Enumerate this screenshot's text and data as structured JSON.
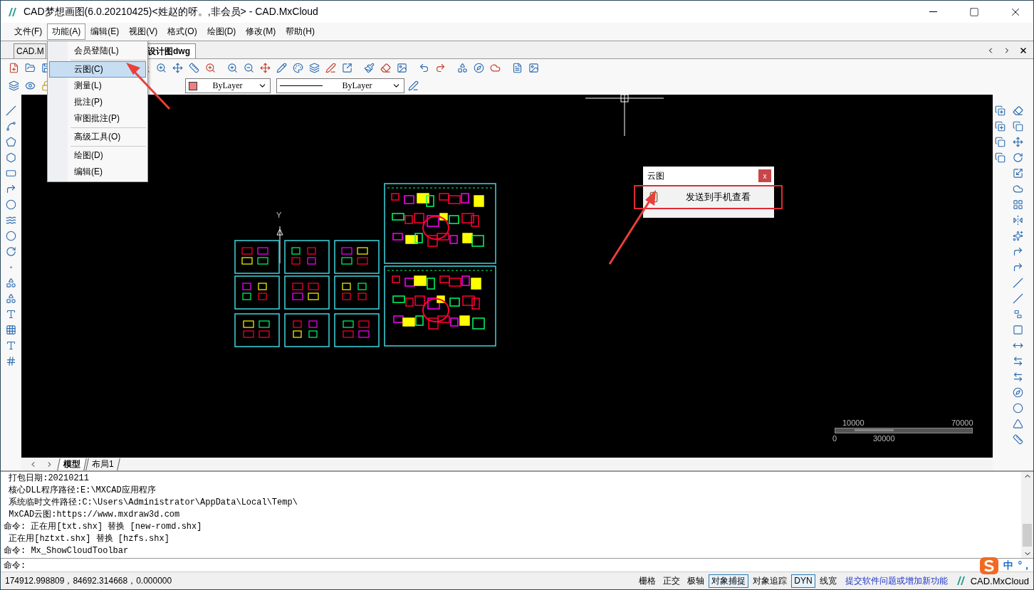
{
  "window": {
    "title": "CAD梦想画图(6.0.20210425)<姓赵的呀。,非会员> - CAD.MxCloud"
  },
  "menu_bar": [
    {
      "label": "文件(F)",
      "selected": false
    },
    {
      "label": "功能(A)",
      "selected": true
    },
    {
      "label": "编辑(E)",
      "selected": false
    },
    {
      "label": "视图(V)",
      "selected": false
    },
    {
      "label": "格式(O)",
      "selected": false
    },
    {
      "label": "绘图(D)",
      "selected": false
    },
    {
      "label": "修改(M)",
      "selected": false
    },
    {
      "label": "帮助(H)",
      "selected": false
    }
  ],
  "open_menu": {
    "items": [
      {
        "label": "会员登陆(L)",
        "selected": false,
        "separator_after": true
      },
      {
        "label": "云图(C)",
        "selected": true,
        "separator_after": false
      },
      {
        "label": "测量(L)",
        "selected": false,
        "separator_after": false
      },
      {
        "label": "批注(P)",
        "selected": false,
        "separator_after": false
      },
      {
        "label": "审图批注(P)",
        "selected": false,
        "separator_after": true
      },
      {
        "label": "高级工具(O)",
        "selected": false,
        "separator_after": true
      },
      {
        "label": "绘图(D)",
        "selected": false,
        "separator_after": false
      },
      {
        "label": "编辑(E)",
        "selected": false,
        "separator_after": false
      }
    ]
  },
  "document_tabs": [
    {
      "label": "CAD.M",
      "selected": false
    },
    {
      "label": "设计图dwg",
      "selected": true
    }
  ],
  "property_bar": {
    "swatch_dropdown": "ByLayer",
    "linetype_dropdown": "ByLayer"
  },
  "canvas": {
    "axis_label": "Y",
    "scale_bar": {
      "top_labels": [
        "10000",
        "70000"
      ],
      "bottom_labels": [
        "0",
        "30000"
      ]
    }
  },
  "cloud_panel": {
    "title": "云图",
    "close": "x",
    "items": [
      {
        "label": "发送到手机查看",
        "highlighted": true
      }
    ]
  },
  "layout_tabs": [
    {
      "label": "模型",
      "selected": true
    },
    {
      "label": "布局1",
      "selected": false
    }
  ],
  "command_output": [
    " 打包日期:20210211",
    " 核心DLL程序路径:E:\\MXCAD应用程序",
    " 系统临时文件路径:C:\\Users\\Administrator\\AppData\\Local\\Temp\\",
    " MxCAD云图:https://www.mxdraw3d.com",
    "命令: 正在用[txt.shx] 替换 [new-romd.shx]",
    " 正在用[hztxt.shx] 替换 [hzfs.shx]",
    "命令: Mx_ShowCloudToolbar"
  ],
  "command_prompt": "命令:",
  "status_bar": {
    "coordinates": "174912.998809，84692.314668，0.000000",
    "toggles": [
      {
        "label": "栅格",
        "on": false
      },
      {
        "label": "正交",
        "on": false
      },
      {
        "label": "极轴",
        "on": false
      },
      {
        "label": "对象捕捉",
        "on": true
      },
      {
        "label": "对象追踪",
        "on": false
      },
      {
        "label": "DYN",
        "on": true
      },
      {
        "label": "线宽",
        "on": false
      }
    ],
    "feedback_link": "提交软件问题或增加新功能",
    "brand": "CAD.MxCloud"
  },
  "ime": {
    "mode": "中",
    "punctuation": "°，"
  }
}
